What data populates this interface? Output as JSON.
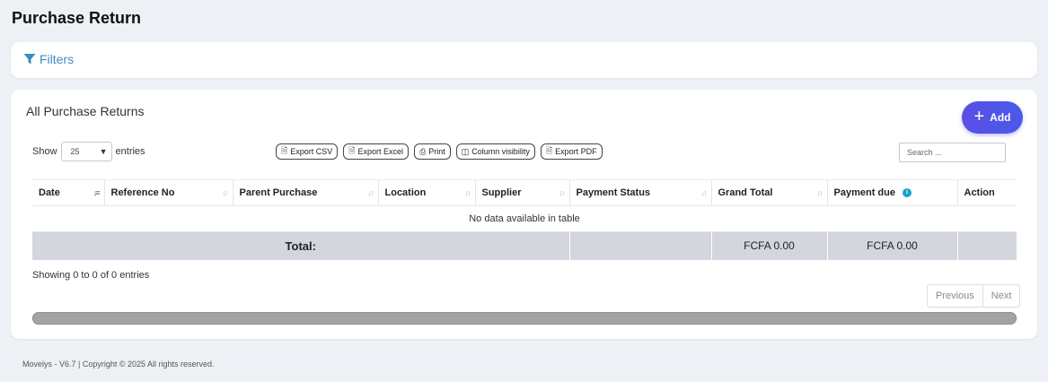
{
  "page": {
    "title": "Purchase Return"
  },
  "filters": {
    "label": "Filters"
  },
  "main": {
    "title": "All Purchase Returns",
    "add_label": "Add",
    "length": {
      "prefix": "Show",
      "value": "25",
      "suffix": "entries"
    },
    "buttons": [
      {
        "label": "Export CSV",
        "icon": "file-csv-icon"
      },
      {
        "label": "Export Excel",
        "icon": "file-excel-icon"
      },
      {
        "label": "Print",
        "icon": "print-icon"
      },
      {
        "label": "Column visibility",
        "icon": "columns-icon"
      },
      {
        "label": "Export PDF",
        "icon": "file-pdf-icon"
      }
    ],
    "search_placeholder": "Search ...",
    "table": {
      "columns": [
        "Date",
        "Reference No",
        "Parent Purchase",
        "Location",
        "Supplier",
        "Payment Status",
        "Grand Total",
        "Payment due",
        "Action"
      ],
      "empty_message": "No data available in table",
      "total_label": "Total:",
      "grand_total": "FCFA 0.00",
      "payment_due_total": "FCFA 0.00"
    },
    "info": "Showing 0 to 0 of 0 entries",
    "pager": {
      "previous": "Previous",
      "next": "Next"
    }
  },
  "footer": {
    "text": "Movelys - V6.7 | Copyright © 2025 All rights reserved."
  },
  "colors": {
    "accent": "#5b4ee6",
    "link": "#3c8dbc",
    "info": "#17a2c9",
    "total_row": "#d3d6dd",
    "background": "#edf0f5"
  }
}
